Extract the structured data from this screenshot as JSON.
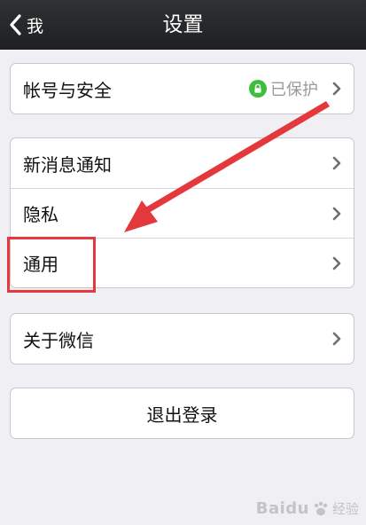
{
  "nav": {
    "back_label": "我",
    "title": "设置"
  },
  "groups": [
    {
      "items": [
        {
          "label": "帐号与安全",
          "status": "已保护"
        }
      ]
    },
    {
      "items": [
        {
          "label": "新消息通知"
        },
        {
          "label": "隐私"
        },
        {
          "label": "通用"
        }
      ]
    },
    {
      "items": [
        {
          "label": "关于微信"
        }
      ]
    }
  ],
  "logout": {
    "label": "退出登录"
  },
  "watermark": {
    "brand": "Baidu",
    "sub": "经验"
  },
  "colors": {
    "navbar": "#2a2b2d",
    "background": "#efeff4",
    "lock_green": "#3fbd3d",
    "annotation_red": "#e4393c"
  }
}
